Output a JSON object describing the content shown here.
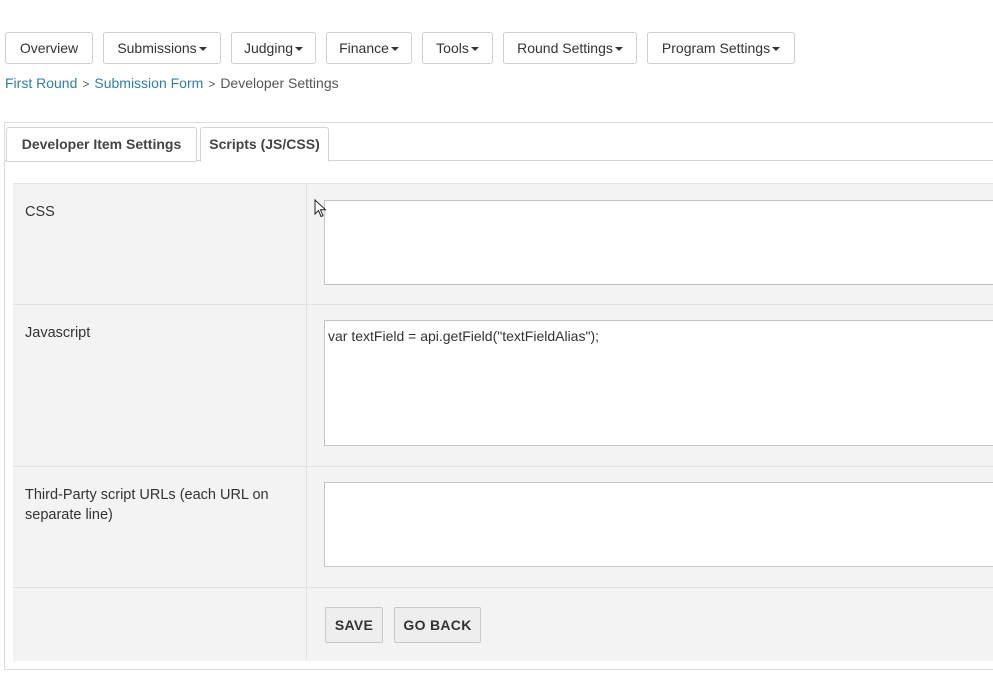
{
  "topnav": {
    "overview": "Overview",
    "submissions": "Submissions",
    "judging": "Judging",
    "finance": "Finance",
    "tools": "Tools",
    "round_settings": "Round Settings",
    "program_settings": "Program Settings"
  },
  "breadcrumb": {
    "first_round": "First Round",
    "separator": ">",
    "submission_form": "Submission Form",
    "current": "Developer Settings"
  },
  "tabs": {
    "developer_item_settings": "Developer Item Settings",
    "scripts": "Scripts (JS/CSS)"
  },
  "form": {
    "css": {
      "label": "CSS",
      "value": ""
    },
    "javascript": {
      "label": "Javascript",
      "value": "var textField = api.getField(\"textFieldAlias\");"
    },
    "third_party": {
      "label": "Third-Party script URLs (each URL on separate line)",
      "value": ""
    }
  },
  "actions": {
    "save": "SAVE",
    "go_back": "GO BACK"
  },
  "icons": {
    "dropdown": "caret-down-icon",
    "pointer": "mouse-cursor-icon"
  },
  "colors": {
    "link": "#2f7fa5",
    "form_background": "#f3f3f3",
    "button_background": "#eeeeee"
  }
}
